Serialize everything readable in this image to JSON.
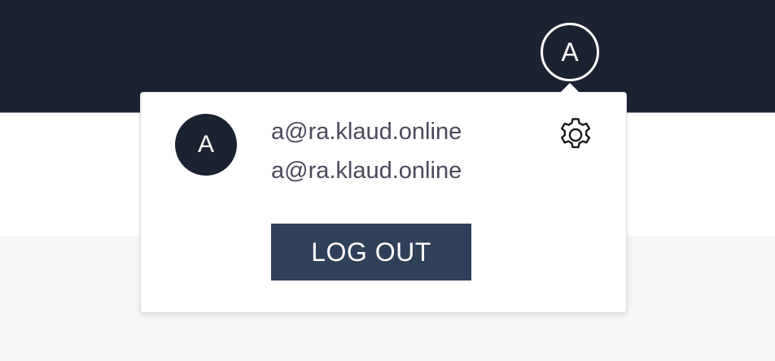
{
  "header": {
    "avatar_initial": "A"
  },
  "account_menu": {
    "avatar_initial": "A",
    "display_name": "a@ra.klaud.online",
    "email": "a@ra.klaud.online",
    "settings_icon": "gear-icon",
    "logout_label": "LOG OUT"
  },
  "colors": {
    "header_bg": "#1b2232",
    "button_bg": "#2f4059",
    "text": "#4a4a5c",
    "page_bg": "#f6f6f7"
  }
}
